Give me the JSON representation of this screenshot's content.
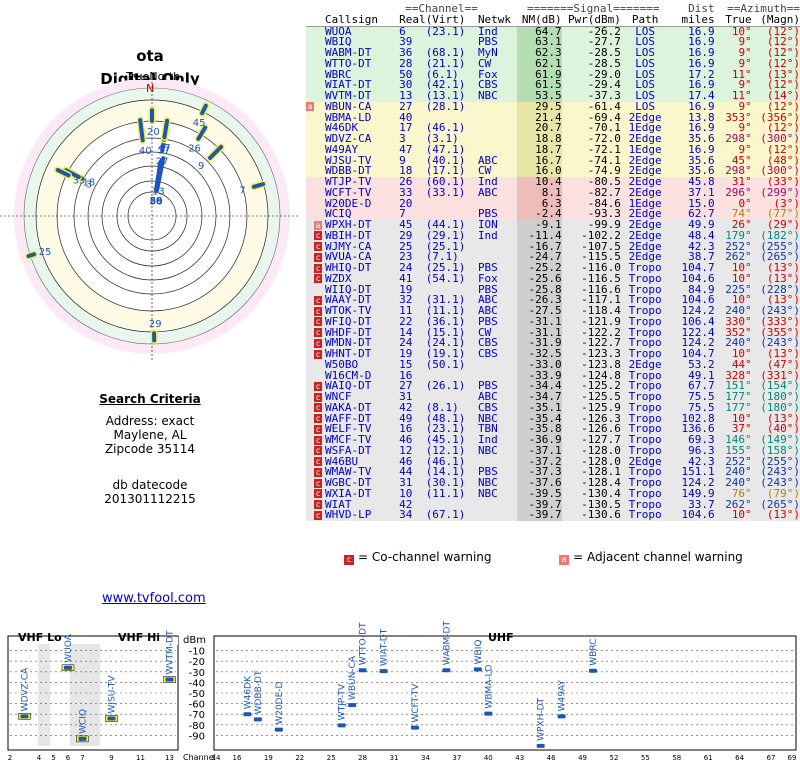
{
  "page": {
    "title": "ota",
    "subtitle": "Digital Only",
    "true_north": "TrueNorth",
    "north_mark": "N",
    "link": "www.tvfool.com"
  },
  "search": {
    "heading": "Search Criteria",
    "lines": [
      "Address: exact",
      "Maylene, AL",
      "Zipcode 35114",
      "",
      "db datecode",
      "201301112215"
    ]
  },
  "table": {
    "group_headers": [
      "==Channel==",
      "=======Signal=======",
      "Dist",
      "==Azimuth=="
    ],
    "columns": [
      "Callsign",
      "Real",
      "(Virt)",
      "Netwk",
      "NM(dB)",
      "Pwr(dBm)",
      "Path",
      "miles",
      "True",
      "(Magn)"
    ],
    "rows": [
      [
        "WUOA",
        "6",
        "(23.1)",
        "Ind",
        "64.7",
        "-26.2",
        "LOS",
        "16.9",
        "10°",
        "(12°)",
        "",
        "green"
      ],
      [
        "WBIQ",
        "39",
        "",
        "PBS",
        "63.1",
        "-27.7",
        "LOS",
        "16.9",
        "9°",
        "(12°)",
        "",
        "green"
      ],
      [
        "WABM-DT",
        "36",
        "(68.1)",
        "MyN",
        "62.3",
        "-28.5",
        "LOS",
        "16.9",
        "9°",
        "(12°)",
        "",
        "green"
      ],
      [
        "WTTO-DT",
        "28",
        "(21.1)",
        "CW",
        "62.1",
        "-28.5",
        "LOS",
        "16.9",
        "9°",
        "(12°)",
        "",
        "green"
      ],
      [
        "WBRC",
        "50",
        "(6.1)",
        "Fox",
        "61.9",
        "-29.0",
        "LOS",
        "17.2",
        "11°",
        "(13°)",
        "",
        "green"
      ],
      [
        "WIAT-DT",
        "30",
        "(42.1)",
        "CBS",
        "61.5",
        "-29.4",
        "LOS",
        "16.9",
        "9°",
        "(12°)",
        "",
        "green"
      ],
      [
        "WVTM-DT",
        "13",
        "(13.1)",
        "NBC",
        "53.5",
        "-37.3",
        "LOS",
        "17.4",
        "11°",
        "(14°)",
        "",
        "green"
      ],
      [
        "WBUN-CA",
        "27",
        "(28.1)",
        "",
        "29.5",
        "-61.4",
        "LOS",
        "16.9",
        "9°",
        "(12°)",
        "a",
        "yellow"
      ],
      [
        "WBMA-LD",
        "40",
        "",
        "",
        "21.4",
        "-69.4",
        "2Edge",
        "13.8",
        "353°",
        "(356°)",
        "",
        "yellow"
      ],
      [
        "W46DK",
        "17",
        "(46.1)",
        "",
        "20.7",
        "-70.1",
        "1Edge",
        "16.9",
        "9°",
        "(12°)",
        "",
        "yellow"
      ],
      [
        "WDVZ-CA",
        "3",
        "(3.1)",
        "",
        "18.8",
        "-72.0",
        "2Edge",
        "35.6",
        "298°",
        "(300°)",
        "",
        "yellow"
      ],
      [
        "W49AY",
        "47",
        "(47.1)",
        "",
        "18.7",
        "-72.1",
        "1Edge",
        "16.9",
        "9°",
        "(12°)",
        "",
        "yellow"
      ],
      [
        "WJSU-TV",
        "9",
        "(40.1)",
        "ABC",
        "16.7",
        "-74.1",
        "2Edge",
        "35.6",
        "45°",
        "(48°)",
        "",
        "yellow"
      ],
      [
        "WDBB-DT",
        "18",
        "(17.1)",
        "CW",
        "16.0",
        "-74.9",
        "2Edge",
        "35.6",
        "298°",
        "(300°)",
        "",
        "yellow"
      ],
      [
        "WTJP-TV",
        "26",
        "(60.1)",
        "Ind",
        "10.4",
        "-80.5",
        "2Edge",
        "45.8",
        "31°",
        "(33°)",
        "",
        "red"
      ],
      [
        "WCFT-TV",
        "33",
        "(33.1)",
        "ABC",
        "8.1",
        "-82.7",
        "2Edge",
        "37.1",
        "296°",
        "(299°)",
        "",
        "red"
      ],
      [
        "W20DE-D",
        "20",
        "",
        "",
        "6.3",
        "-84.6",
        "1Edge",
        "15.0",
        "0°",
        "(3°)",
        "",
        "red"
      ],
      [
        "WCIQ",
        "7",
        "",
        "PBS",
        "-2.4",
        "-93.3",
        "2Edge",
        "62.7",
        "74°",
        "(77°)",
        "",
        "red"
      ],
      [
        "WPXH-DT",
        "45",
        "(44.1)",
        "ION",
        "-9.1",
        "-99.9",
        "2Edge",
        "49.9",
        "26°",
        "(29°)",
        "a",
        "gray"
      ],
      [
        "WBIH-DT",
        "29",
        "(29.1)",
        "Ind",
        "-11.4",
        "-102.2",
        "2Edge",
        "48.4",
        "179°",
        "(182°)",
        "c",
        "gray"
      ],
      [
        "WJMY-CA",
        "25",
        "(25.1)",
        "",
        "-16.7",
        "-107.5",
        "2Edge",
        "42.3",
        "252°",
        "(255°)",
        "c",
        "gray"
      ],
      [
        "WVUA-CA",
        "23",
        "(7.1)",
        "",
        "-24.7",
        "-115.5",
        "2Edge",
        "38.7",
        "262°",
        "(265°)",
        "c",
        "gray"
      ],
      [
        "WHIQ-DT",
        "24",
        "(25.1)",
        "PBS",
        "-25.2",
        "-116.0",
        "Tropo",
        "104.7",
        "10°",
        "(13°)",
        "c",
        "gray"
      ],
      [
        "WZDX",
        "41",
        "(54.1)",
        "Fox",
        "-25.6",
        "-116.5",
        "Tropo",
        "104.6",
        "10°",
        "(13°)",
        "c",
        "gray"
      ],
      [
        "WIIQ-DT",
        "19",
        "",
        "PBS",
        "-25.8",
        "-116.6",
        "Tropo",
        "84.9",
        "225°",
        "(228°)",
        "",
        "gray"
      ],
      [
        "WAAY-DT",
        "32",
        "(31.1)",
        "ABC",
        "-26.3",
        "-117.1",
        "Tropo",
        "104.6",
        "10°",
        "(13°)",
        "c",
        "gray"
      ],
      [
        "WTOK-TV",
        "11",
        "(11.1)",
        "ABC",
        "-27.5",
        "-118.4",
        "Tropo",
        "124.2",
        "240°",
        "(243°)",
        "c",
        "gray"
      ],
      [
        "WFIQ-DT",
        "22",
        "(36.1)",
        "PBS",
        "-31.1",
        "-121.9",
        "Tropo",
        "106.4",
        "330°",
        "(333°)",
        "c",
        "gray"
      ],
      [
        "WHDF-DT",
        "14",
        "(15.1)",
        "CW",
        "-31.1",
        "-122.2",
        "Tropo",
        "122.4",
        "352°",
        "(355°)",
        "c",
        "gray"
      ],
      [
        "WMDN-DT",
        "24",
        "(24.1)",
        "CBS",
        "-31.9",
        "-122.7",
        "Tropo",
        "124.2",
        "240°",
        "(243°)",
        "c",
        "gray"
      ],
      [
        "WHNT-DT",
        "19",
        "(19.1)",
        "CBS",
        "-32.5",
        "-123.3",
        "Tropo",
        "104.7",
        "10°",
        "(13°)",
        "c",
        "gray"
      ],
      [
        "W50BO",
        "15",
        "(50.1)",
        "",
        "-33.0",
        "-123.8",
        "2Edge",
        "53.2",
        "44°",
        "(47°)",
        "",
        "gray"
      ],
      [
        "W16CM-D",
        "16",
        "",
        "",
        "-33.9",
        "-124.8",
        "Tropo",
        "49.1",
        "328°",
        "(331°)",
        "",
        "gray"
      ],
      [
        "WAIQ-DT",
        "27",
        "(26.1)",
        "PBS",
        "-34.4",
        "-125.2",
        "Tropo",
        "67.7",
        "151°",
        "(154°)",
        "c",
        "gray"
      ],
      [
        "WNCF",
        "31",
        "",
        "ABC",
        "-34.7",
        "-125.5",
        "Tropo",
        "75.5",
        "177°",
        "(180°)",
        "c",
        "gray"
      ],
      [
        "WAKA-DT",
        "42",
        "(8.1)",
        "CBS",
        "-35.1",
        "-125.9",
        "Tropo",
        "75.5",
        "177°",
        "(180°)",
        "c",
        "gray"
      ],
      [
        "WAFF-DT",
        "49",
        "(48.1)",
        "NBC",
        "-35.4",
        "-126.3",
        "Tropo",
        "102.8",
        "10°",
        "(13°)",
        "c",
        "gray"
      ],
      [
        "WELF-TV",
        "16",
        "(23.1)",
        "TBN",
        "-35.8",
        "-126.6",
        "Tropo",
        "136.6",
        "37°",
        "(40°)",
        "c",
        "gray"
      ],
      [
        "WMCF-TV",
        "46",
        "(45.1)",
        "Ind",
        "-36.9",
        "-127.7",
        "Tropo",
        "69.3",
        "146°",
        "(149°)",
        "c",
        "gray"
      ],
      [
        "WSFA-DT",
        "12",
        "(12.1)",
        "NBC",
        "-37.1",
        "-128.0",
        "Tropo",
        "96.3",
        "155°",
        "(158°)",
        "c",
        "gray"
      ],
      [
        "W46BU",
        "46",
        "(46.1)",
        "",
        "-37.2",
        "-128.0",
        "2Edge",
        "42.3",
        "252°",
        "(255°)",
        "c",
        "gray"
      ],
      [
        "WMAW-TV",
        "44",
        "(14.1)",
        "PBS",
        "-37.3",
        "-128.1",
        "Tropo",
        "151.1",
        "240°",
        "(243°)",
        "c",
        "gray"
      ],
      [
        "WGBC-DT",
        "31",
        "(30.1)",
        "NBC",
        "-37.6",
        "-128.4",
        "Tropo",
        "124.2",
        "240°",
        "(243°)",
        "c",
        "gray"
      ],
      [
        "WXIA-DT",
        "10",
        "(11.1)",
        "NBC",
        "-39.5",
        "-130.4",
        "Tropo",
        "149.9",
        "76°",
        "(79°)",
        "c",
        "gray"
      ],
      [
        "WIAT",
        "42",
        "",
        "",
        "-39.7",
        "-130.5",
        "Tropo",
        "33.7",
        "262°",
        "(265°)",
        "c",
        "gray"
      ],
      [
        "WHVD-LP",
        "34",
        "(67.1)",
        "",
        "-39.7",
        "-130.6",
        "Tropo",
        "104.6",
        "10°",
        "(13°)",
        "c",
        "gray"
      ]
    ]
  },
  "legend": {
    "co_mark": "c",
    "co_label": "= Co-channel warning",
    "adj_mark": "a",
    "adj_label": "= Adjacent channel warning"
  },
  "colors": {
    "green": "#dcf3dc",
    "yellow": "#fbf7cd",
    "red": "#fbe0e0",
    "gray": "#e8e8e8",
    "nm_green": "#b5deb5",
    "nm_yellow": "#e9e5a6",
    "nm_red": "#efbcbc",
    "nm_gray": "#cfcfcf",
    "co": "#cc2222",
    "adj": "#ee7777",
    "mark": "#1f55b8",
    "mark_outline": "#f2f23a",
    "link": "#0000cc"
  },
  "polar": {
    "ring_labels_note": "",
    "stations": [
      {
        "ch": "6",
        "az": 10,
        "nm": 64.7
      },
      {
        "ch": "39",
        "az": 9,
        "nm": 63.1
      },
      {
        "ch": "36",
        "az": 9,
        "nm": 62.3
      },
      {
        "ch": "28",
        "az": 9,
        "nm": 62.1
      },
      {
        "ch": "50",
        "az": 11,
        "nm": 61.9
      },
      {
        "ch": "30",
        "az": 9,
        "nm": 61.5
      },
      {
        "ch": "13",
        "az": 11,
        "nm": 53.5
      },
      {
        "ch": "27",
        "az": 9,
        "nm": 29.5
      },
      {
        "ch": "40",
        "az": 353,
        "nm": 21.4
      },
      {
        "ch": "17",
        "az": 9,
        "nm": 20.7
      },
      {
        "ch": "3",
        "az": 298,
        "nm": 18.8
      },
      {
        "ch": "47",
        "az": 9,
        "nm": 18.7
      },
      {
        "ch": "9",
        "az": 45,
        "nm": 16.7
      },
      {
        "ch": "18",
        "az": 298,
        "nm": 16.0
      },
      {
        "ch": "26",
        "az": 31,
        "nm": 10.4
      },
      {
        "ch": "33",
        "az": 296,
        "nm": 8.1
      },
      {
        "ch": "20",
        "az": 0,
        "nm": 6.3
      },
      {
        "ch": "7",
        "az": 74,
        "nm": -2.4
      },
      {
        "ch": "45",
        "az": 26,
        "nm": -9.1
      },
      {
        "ch": "29",
        "az": 179,
        "nm": -11.4
      },
      {
        "ch": "25",
        "az": 252,
        "nm": -16.7
      }
    ],
    "labels": [
      "45",
      "26",
      "9",
      "40",
      "20",
      "30",
      "33",
      "18",
      "3",
      "39",
      "7",
      "29",
      "25",
      "27",
      "13",
      "6",
      "50"
    ]
  },
  "spectrum": {
    "vhf_lo": "VHF Lo",
    "vhf_hi": "VHF Hi",
    "uhf": "UHF",
    "dbm": "dBm",
    "y_ticks": [
      "-10",
      "-20",
      "-30",
      "-40",
      "-50",
      "-60",
      "-70",
      "-80",
      "-90"
    ],
    "channel_label": "Channel",
    "vhf_ticks": [
      "2",
      "4",
      "5",
      "6",
      "7",
      "9",
      "11",
      "13"
    ],
    "uhf_ticks": [
      "14",
      "16",
      "19",
      "22",
      "25",
      "28",
      "31",
      "34",
      "37",
      "40",
      "43",
      "46",
      "49",
      "52",
      "55",
      "58",
      "61",
      "64",
      "67",
      "69"
    ],
    "bars": [
      {
        "name": "WDVZ-CA",
        "ch": 3,
        "pwr": -72.0
      },
      {
        "name": "WUOA",
        "ch": 6,
        "pwr": -26.2
      },
      {
        "name": "WCIQ",
        "ch": 7,
        "pwr": -93.3
      },
      {
        "name": "WJSU-TV",
        "ch": 9,
        "pwr": -74.1
      },
      {
        "name": "WVTM-DT",
        "ch": 13,
        "pwr": -37.3
      },
      {
        "name": "W46DK",
        "ch": 17,
        "pwr": -70.1
      },
      {
        "name": "WDBB-DT",
        "ch": 18,
        "pwr": -74.9
      },
      {
        "name": "W20DE-D",
        "ch": 20,
        "pwr": -84.6
      },
      {
        "name": "WTJP-TV",
        "ch": 26,
        "pwr": -80.5
      },
      {
        "name": "WBUN-CA",
        "ch": 27,
        "pwr": -61.4
      },
      {
        "name": "WTTO-DT",
        "ch": 28,
        "pwr": -28.5
      },
      {
        "name": "WIAT-DT",
        "ch": 30,
        "pwr": -29.4
      },
      {
        "name": "WCFT-TV",
        "ch": 33,
        "pwr": -82.7
      },
      {
        "name": "WABM-DT",
        "ch": 36,
        "pwr": -28.5
      },
      {
        "name": "WBIQ",
        "ch": 39,
        "pwr": -27.7
      },
      {
        "name": "WBMA-LD",
        "ch": 40,
        "pwr": -69.4
      },
      {
        "name": "WPXH-DT",
        "ch": 45,
        "pwr": -99.9
      },
      {
        "name": "W49AY",
        "ch": 47,
        "pwr": -72.1
      },
      {
        "name": "WBRC",
        "ch": 50,
        "pwr": -29.0
      }
    ]
  }
}
